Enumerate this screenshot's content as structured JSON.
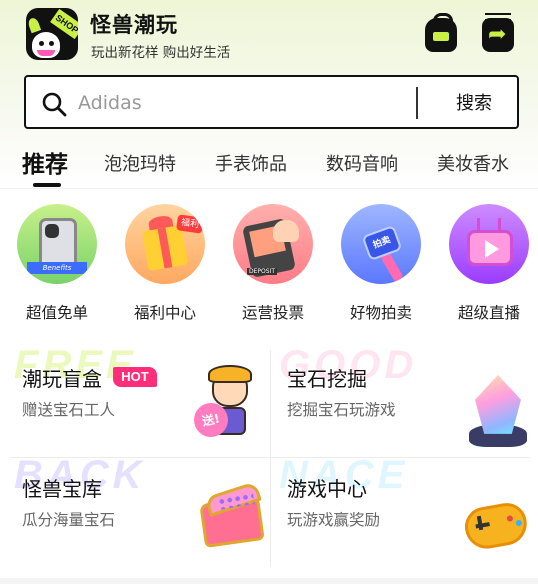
{
  "header": {
    "app_name": "怪兽潮玩",
    "slogan": "玩出新花样 购出好生活",
    "logo_text": "SHOP",
    "icons": [
      "backpack-icon",
      "share-icon"
    ]
  },
  "search": {
    "placeholder": "Adidas",
    "button_label": "搜索"
  },
  "tabs": [
    {
      "label": "推荐",
      "active": true
    },
    {
      "label": "泡泡玛特",
      "active": false
    },
    {
      "label": "手表饰品",
      "active": false
    },
    {
      "label": "数码音响",
      "active": false
    },
    {
      "label": "美妆香水",
      "active": false
    }
  ],
  "categories": [
    {
      "label": "超值免单",
      "badge": "Benefits",
      "color": "#79d26a"
    },
    {
      "label": "福利中心",
      "badge": "福利",
      "color": "#ffa860"
    },
    {
      "label": "运营投票",
      "badge": "DEPOSIT",
      "color": "#ff7c87"
    },
    {
      "label": "好物拍卖",
      "badge": "拍卖",
      "color": "#5b78ff"
    },
    {
      "label": "超级直播",
      "color": "#9b3cff"
    }
  ],
  "cards": [
    {
      "title": "潮玩盲盒",
      "subtitle": "赠送宝石工人",
      "badge": "HOT",
      "bg_text": "FREE",
      "bg_color": "#c8f046",
      "figure_badge": "送!"
    },
    {
      "title": "宝石挖掘",
      "subtitle": "挖掘宝石玩游戏",
      "bg_text": "GOOD",
      "bg_color": "#ffb6d9"
    },
    {
      "title": "怪兽宝库",
      "subtitle": "瓜分海量宝石",
      "bg_text": "BACK",
      "bg_color": "#b9a8ff"
    },
    {
      "title": "游戏中心",
      "subtitle": "玩游戏赢奖励",
      "bg_text": "NACE",
      "bg_color": "#a8e8ff"
    }
  ],
  "colors": {
    "accent_lime": "#c8f046",
    "hot_pink": "#ff2d7a",
    "text_dark": "#111111"
  }
}
